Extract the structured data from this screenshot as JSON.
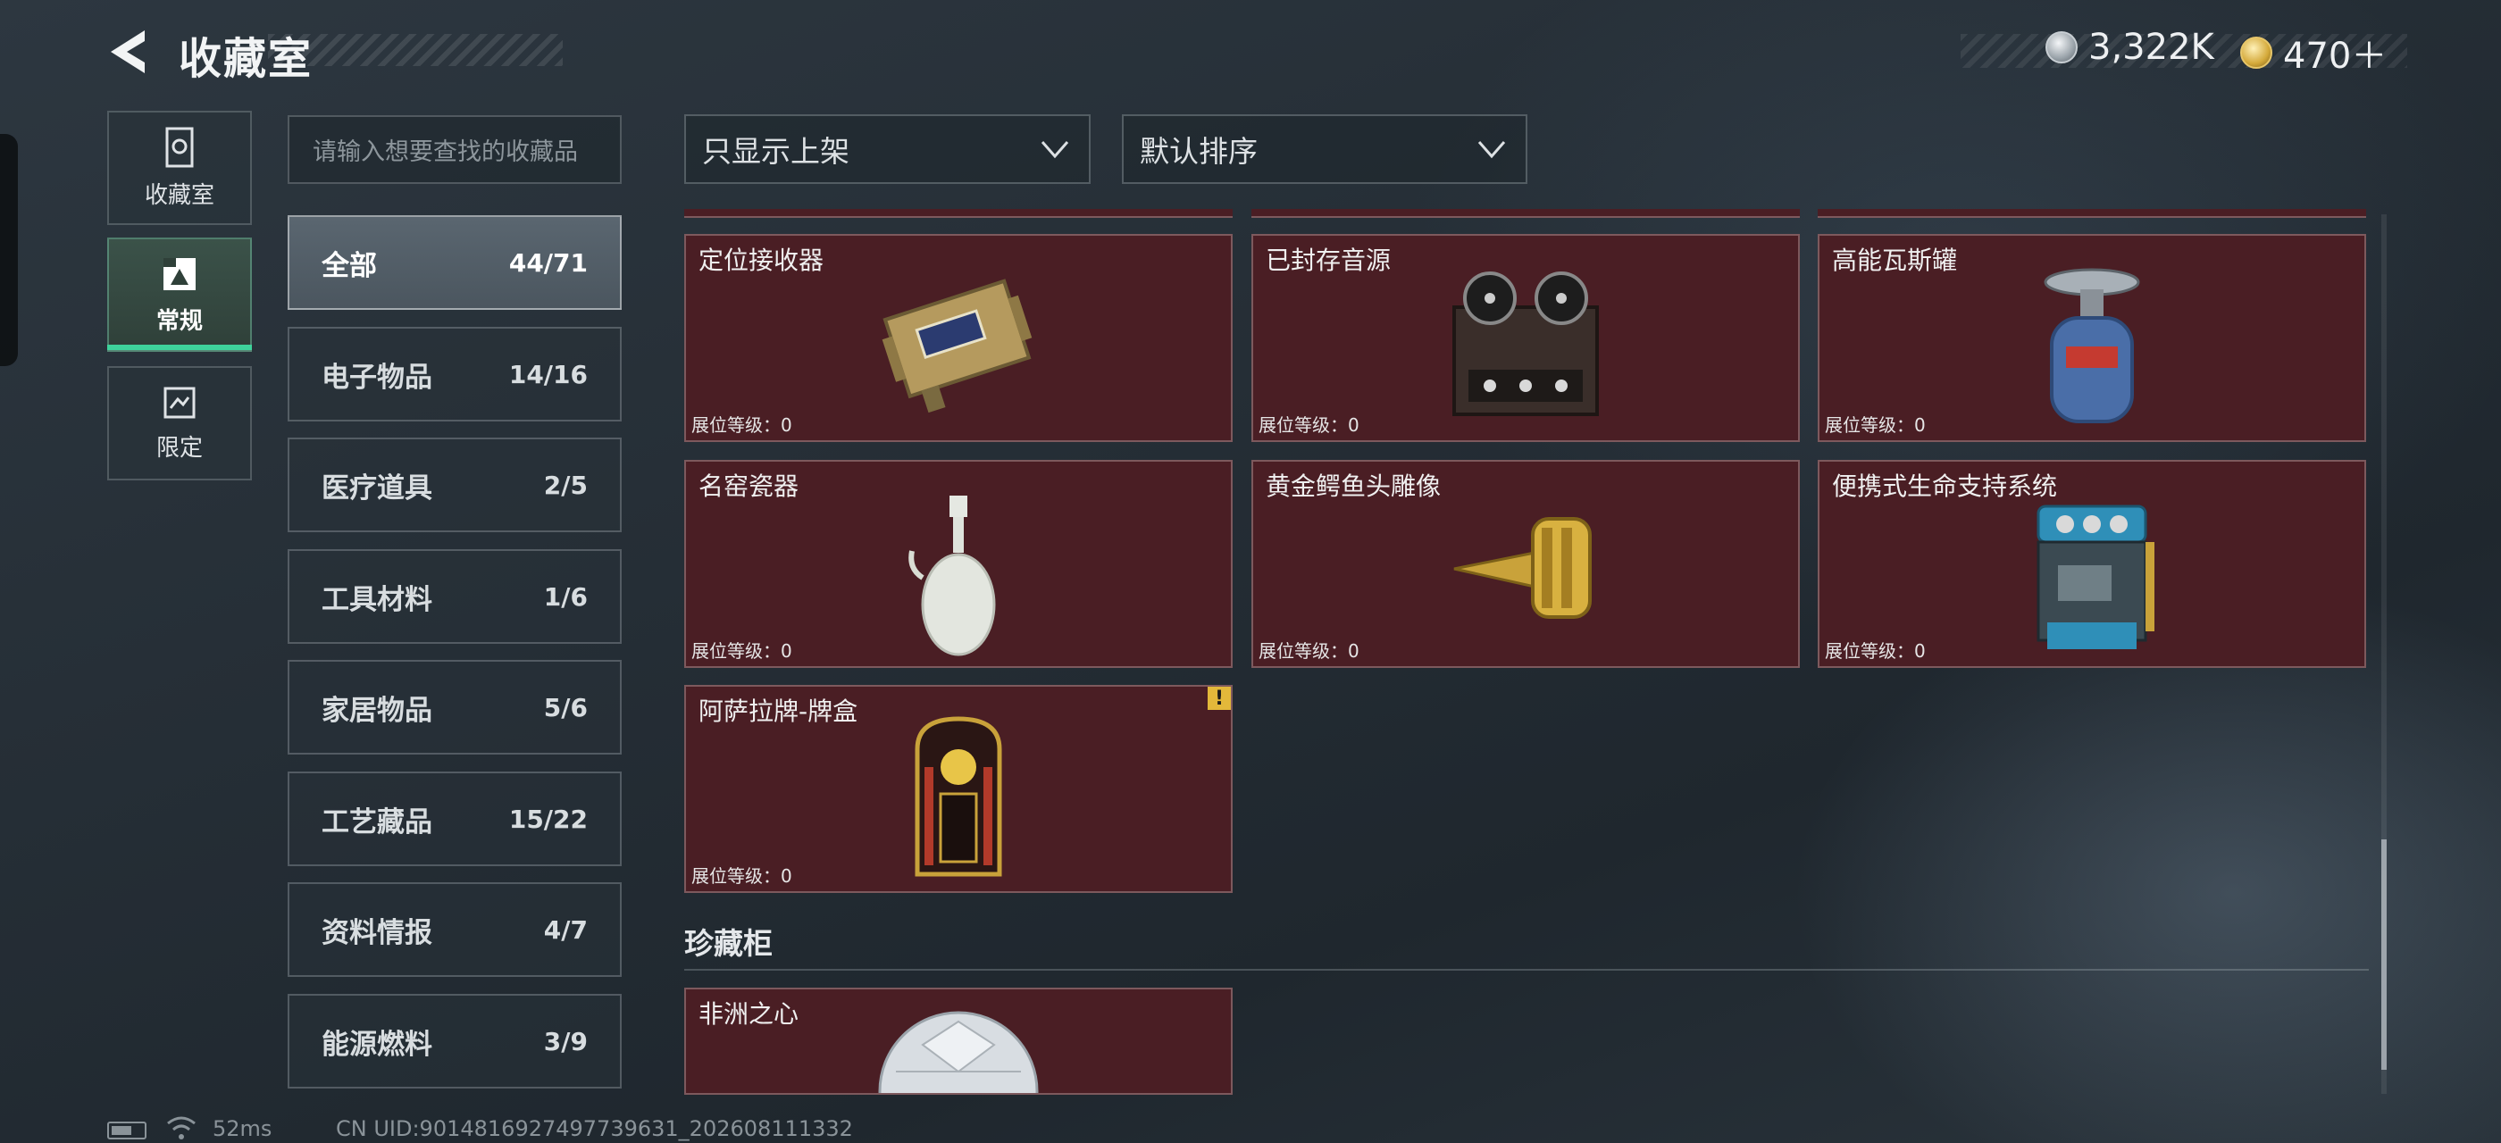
{
  "header": {
    "title": "收藏室"
  },
  "currency": [
    {
      "icon": "silver-coin-icon",
      "value": "3,322K"
    },
    {
      "icon": "gold-coin-icon",
      "value": "470＋"
    }
  ],
  "rail": [
    {
      "label": "收藏室",
      "icon": "vault-icon",
      "active": false
    },
    {
      "label": "常规",
      "icon": "picture-icon",
      "active": true
    },
    {
      "label": "限定",
      "icon": "limited-icon",
      "active": false
    }
  ],
  "search": {
    "placeholder": "请输入想要查找的收藏品"
  },
  "categories": [
    {
      "name": "全部",
      "count": "44/71",
      "active": true
    },
    {
      "name": "电子物品",
      "count": "14/16"
    },
    {
      "name": "医疗道具",
      "count": "2/5"
    },
    {
      "name": "工具材料",
      "count": "1/6"
    },
    {
      "name": "家居物品",
      "count": "5/6"
    },
    {
      "name": "工艺藏品",
      "count": "15/22"
    },
    {
      "name": "资料情报",
      "count": "4/7"
    },
    {
      "name": "能源燃料",
      "count": "3/9"
    }
  ],
  "filters": {
    "display": "只显示上架",
    "sort": "默认排序"
  },
  "items": [
    {
      "name": "定位接收器",
      "level": "展位等级：0",
      "icon": "locator-receiver-icon"
    },
    {
      "name": "已封存音源",
      "level": "展位等级：0",
      "icon": "reel-recorder-icon"
    },
    {
      "name": "高能瓦斯罐",
      "level": "展位等级：0",
      "icon": "gas-canister-icon"
    },
    {
      "name": "名窑瓷器",
      "level": "展位等级：0",
      "icon": "porcelain-vase-icon"
    },
    {
      "name": "黄金鳄鱼头雕像",
      "level": "展位等级：0",
      "icon": "gold-crocodile-icon"
    },
    {
      "name": "便携式生命支持系统",
      "level": "展位等级：0",
      "icon": "life-support-icon"
    },
    {
      "name": "阿萨拉牌-牌盒",
      "level": "展位等级：0",
      "icon": "card-box-icon",
      "warning": "!"
    }
  ],
  "section": {
    "title": "珍藏柜"
  },
  "treasure_items": [
    {
      "name": "非洲之心",
      "icon": "diamond-icon"
    }
  ],
  "status": {
    "ping": "52ms",
    "uid": "CN UID:9014816927497739631_202608111332"
  }
}
